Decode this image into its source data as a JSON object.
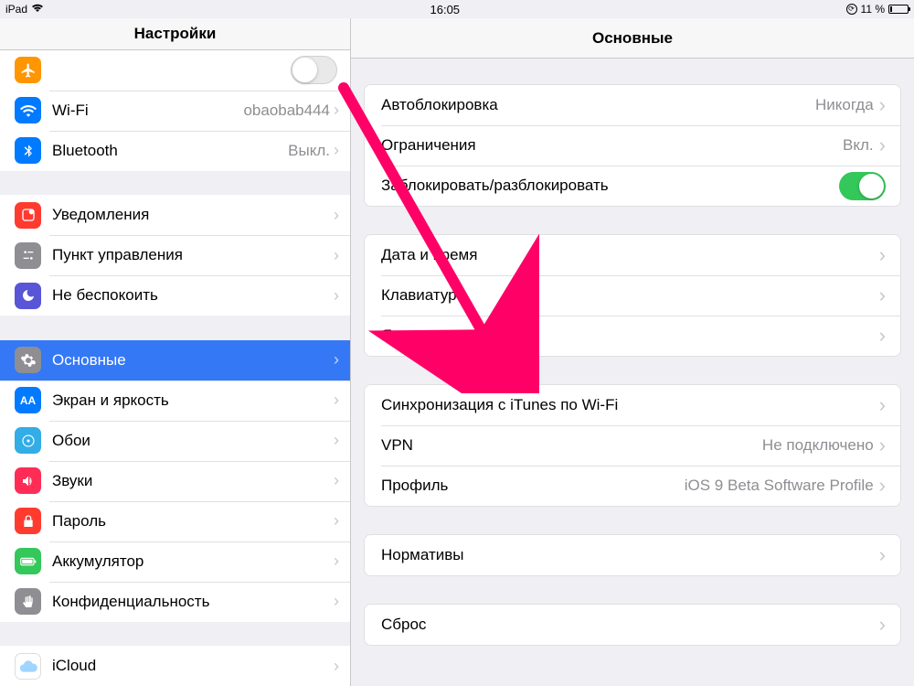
{
  "statusbar": {
    "device": "iPad",
    "time": "16:05",
    "battery_pct": "11 %"
  },
  "sidebar": {
    "title": "Настройки",
    "items": [
      {
        "id": "airplane",
        "label": "",
        "value": "",
        "kind": "toggle",
        "on": false
      },
      {
        "id": "wifi",
        "label": "Wi-Fi",
        "value": "obaobab444"
      },
      {
        "id": "bluetooth",
        "label": "Bluetooth",
        "value": "Выкл."
      },
      {
        "id": "notifications",
        "label": "Уведомления"
      },
      {
        "id": "controlcenter",
        "label": "Пункт управления"
      },
      {
        "id": "dnd",
        "label": "Не беспокоить"
      },
      {
        "id": "general",
        "label": "Основные",
        "selected": true
      },
      {
        "id": "display",
        "label": "Экран и яркость"
      },
      {
        "id": "wallpaper",
        "label": "Обои"
      },
      {
        "id": "sounds",
        "label": "Звуки"
      },
      {
        "id": "passcode",
        "label": "Пароль"
      },
      {
        "id": "battery",
        "label": "Аккумулятор"
      },
      {
        "id": "privacy",
        "label": "Конфиденциальность"
      },
      {
        "id": "icloud",
        "label": "iCloud"
      }
    ]
  },
  "detail": {
    "title": "Основные",
    "sections": [
      [
        {
          "label": "Автоблокировка",
          "value": "Никогда",
          "kind": "link"
        },
        {
          "label": "Ограничения",
          "value": "Вкл.",
          "kind": "link"
        },
        {
          "label": "Заблокировать/разблокировать",
          "kind": "toggle",
          "on": true
        }
      ],
      [
        {
          "label": "Дата и время",
          "kind": "link"
        },
        {
          "label": "Клавиатура",
          "kind": "link"
        },
        {
          "label": "Язык и регион",
          "kind": "link"
        }
      ],
      [
        {
          "label": "Синхронизация с iTunes по Wi-Fi",
          "kind": "link"
        },
        {
          "label": "VPN",
          "value": "Не подключено",
          "kind": "link"
        },
        {
          "label": "Профиль",
          "value": "iOS 9 Beta Software Profile",
          "kind": "link"
        }
      ],
      [
        {
          "label": "Нормативы",
          "kind": "link"
        }
      ],
      [
        {
          "label": "Сброс",
          "kind": "link"
        }
      ]
    ]
  }
}
